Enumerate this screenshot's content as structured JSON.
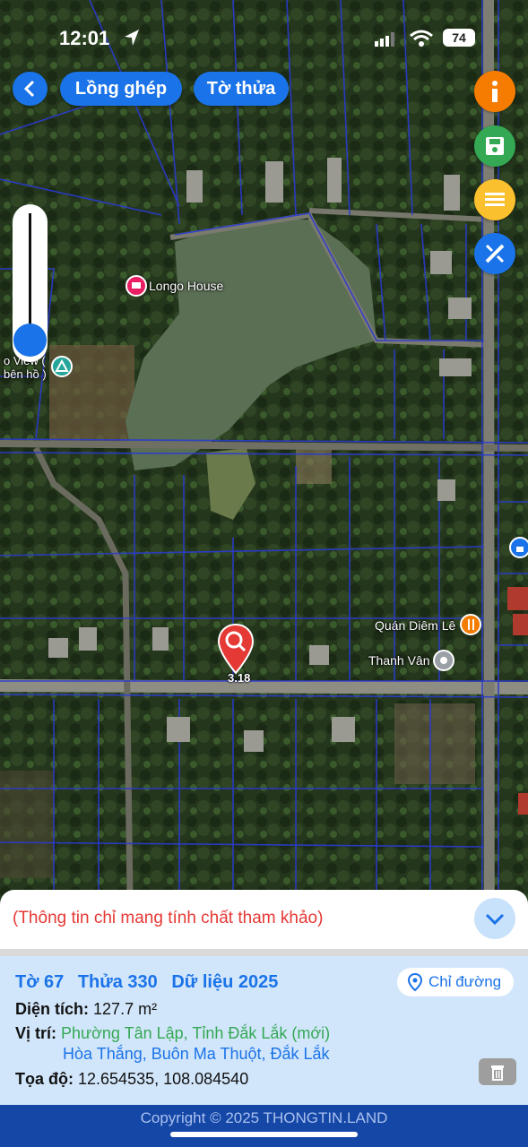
{
  "status_bar": {
    "time": "12:01",
    "battery": "74"
  },
  "toolbar": {
    "mode_merge": "Lồng ghép",
    "mode_parcel": "Tờ thửa"
  },
  "map": {
    "labels": {
      "longo_house": "Longo House",
      "view_line1": "o View (",
      "view_line2": "bên hồ )",
      "quan_diem_le": "Quán Diêm Lê",
      "thanh_van": "Thanh Vân"
    },
    "pin_label": "3.18"
  },
  "panel": {
    "notice": "(Thông tin chỉ mang tính chất tham khảo)",
    "sheet": "Tờ 67",
    "parcel": "Thửa 330",
    "data_year": "Dữ liệu 2025",
    "directions": "Chỉ đường",
    "area_label": "Diện tích:",
    "area_value": "127.7 m²",
    "location_label": "Vị trí:",
    "location_new": "Phường Tân Lập, Tỉnh Đắk Lắk (mới)",
    "location_old": "Hòa Thắng, Buôn Ma Thuột, Đắk Lắk",
    "coords_label": "Tọa độ:",
    "coords_value": "12.654535, 108.084540"
  },
  "footer": {
    "copyright": "Copyright © 2025 THONGTIN.LAND"
  },
  "colors": {
    "primary": "#1a73e8",
    "info": "#f57c00",
    "save": "#34a853",
    "list": "#fbc02d",
    "notice": "#e53935",
    "footer": "#1547a6"
  }
}
